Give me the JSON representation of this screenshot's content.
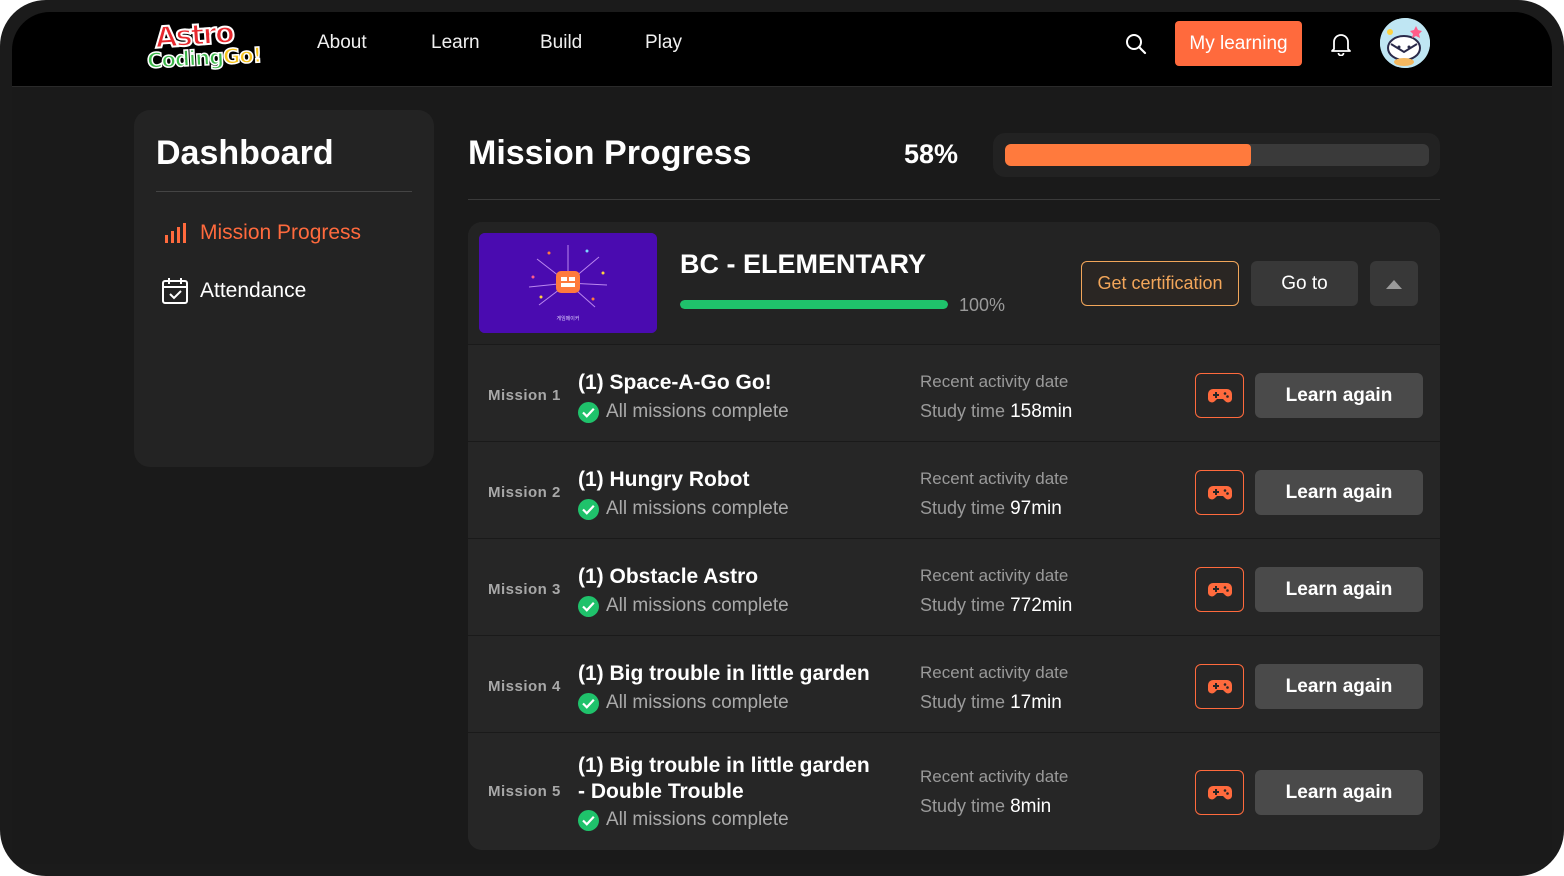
{
  "brand": {
    "logo_line1": "Astro",
    "logo_line2a": "Coding",
    "logo_line2b": "Go!"
  },
  "nav": {
    "items": [
      "About",
      "Learn",
      "Build",
      "Play"
    ]
  },
  "header": {
    "my_learning_label": "My learning"
  },
  "sidebar": {
    "title": "Dashboard",
    "items": [
      {
        "label": "Mission Progress",
        "icon": "bar-chart-icon",
        "active": true
      },
      {
        "label": "Attendance",
        "icon": "calendar-check-icon",
        "active": false
      }
    ]
  },
  "main": {
    "title": "Mission Progress",
    "progress_label": "58%",
    "progress_fraction": 0.58
  },
  "course": {
    "title": "BC - ELEMENTARY",
    "progress_label": "100%",
    "progress_fraction": 1.0,
    "cert_label": "Get certification",
    "goto_label": "Go to",
    "thumb_caption": "게임메이커"
  },
  "missions": [
    {
      "label": "Mission 1",
      "name_line1": "(1) Space-A-Go Go!",
      "name_line2": "",
      "status": "All missions complete",
      "date_label": "Recent activity date",
      "time_label": "Study time",
      "time_value": "158min",
      "action": "Learn again"
    },
    {
      "label": "Mission 2",
      "name_line1": "(1) Hungry Robot",
      "name_line2": "",
      "status": "All missions complete",
      "date_label": "Recent activity date",
      "time_label": "Study time",
      "time_value": "97min",
      "action": "Learn again"
    },
    {
      "label": "Mission 3",
      "name_line1": "(1) Obstacle Astro",
      "name_line2": "",
      "status": "All missions complete",
      "date_label": "Recent activity date",
      "time_label": "Study time",
      "time_value": "772min",
      "action": "Learn again"
    },
    {
      "label": "Mission 4",
      "name_line1": "(1) Big trouble in little garden",
      "name_line2": "",
      "status": "All missions complete",
      "date_label": "Recent activity date",
      "time_label": "Study time",
      "time_value": "17min",
      "action": "Learn again"
    },
    {
      "label": "Mission 5",
      "name_line1": "(1) Big trouble in little garden",
      "name_line2": "- Double Trouble",
      "status": "All missions complete",
      "date_label": "Recent activity date",
      "time_label": "Study time",
      "time_value": "8min",
      "action": "Learn again"
    }
  ],
  "colors": {
    "accent": "#ff6a3d",
    "success": "#1fc26b",
    "cert": "#f2a65a",
    "thumb": "#4a0bb0"
  }
}
